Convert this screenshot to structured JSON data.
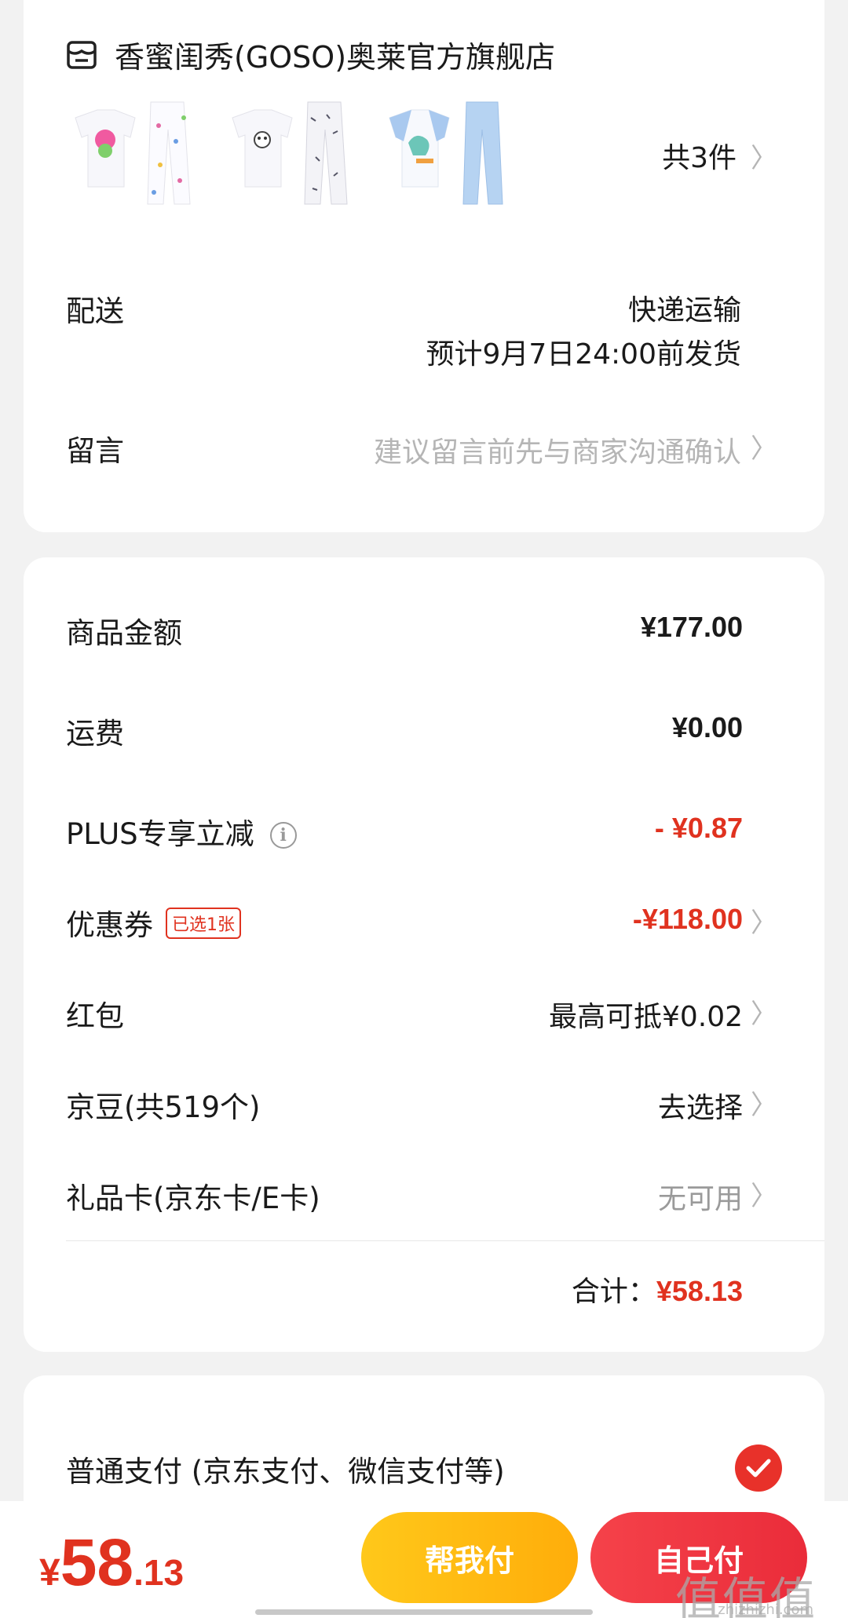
{
  "store": {
    "name": "香蜜闺秀(GOSO)奥莱官方旗舰店",
    "icon": "store-icon",
    "item_count": "共3件"
  },
  "delivery": {
    "label": "配送",
    "method": "快递运输",
    "eta": "预计9月7日24:00前发货"
  },
  "message": {
    "label": "留言",
    "placeholder": "建议留言前先与商家沟通确认"
  },
  "price": {
    "goods_label": "商品金额",
    "goods_value": "¥177.00",
    "freight_label": "运费",
    "freight_value": "¥0.00",
    "plus_label": "PLUS专享立减",
    "plus_value": "- ¥0.87",
    "coupon_label": "优惠券",
    "coupon_badge": "已选1张",
    "coupon_value": "-¥118.00",
    "redpacket_label": "红包",
    "redpacket_value": "最高可抵¥0.02",
    "jingdou_label": "京豆(共519个)",
    "jingdou_value": "去选择",
    "giftcard_label": "礼品卡(京东卡/E卡)",
    "giftcard_value": "无可用",
    "total_label": "合计：",
    "total_value": "¥58.13"
  },
  "payment": {
    "label": "普通支付 (京东支付、微信支付等)",
    "selected": true
  },
  "bottom": {
    "yen": "¥",
    "price_int": "58",
    "price_dec": ".13",
    "help_pay": "帮我付",
    "self_pay": "自己付"
  },
  "watermark": {
    "text": "值值值",
    "sub": "zhizhizhi.com"
  },
  "colors": {
    "accent_red": "#e0321f",
    "help_yellow": "#ffb80f",
    "self_red": "#ee3340"
  }
}
